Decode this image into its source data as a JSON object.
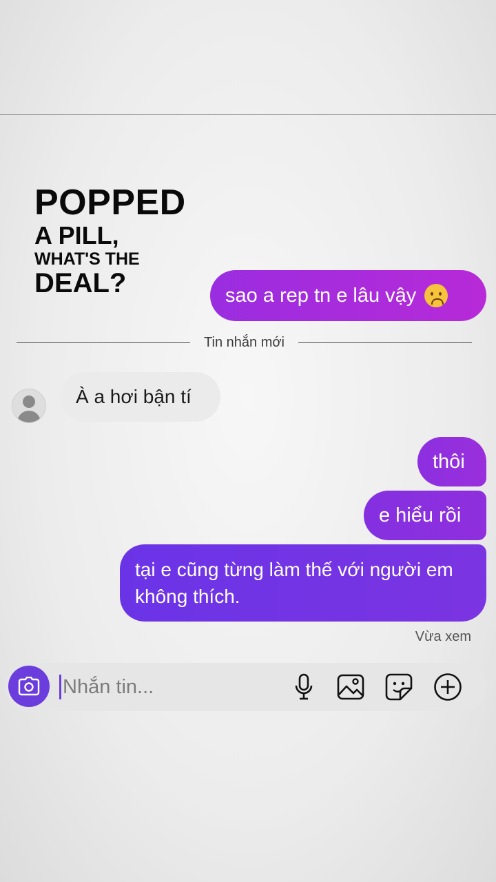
{
  "poster": {
    "line1": "POPPED",
    "line2": "A PILL,",
    "line3": "WHAT'S THE",
    "line4": "DEAL?"
  },
  "messages": {
    "outgoing_1": "sao a rep tn e lâu vậy",
    "outgoing_1_emoji": "frowning-face",
    "divider_label": "Tin nhắn mới",
    "incoming_1": "À a hơi bận tí",
    "outgoing_2": "thôi",
    "outgoing_3": "e hiểu rồi",
    "outgoing_4": "tại e cũng từng làm thế với người em không thích.",
    "seen_status": "Vừa xem"
  },
  "composer": {
    "placeholder": "Nhắn tin...",
    "icons": [
      "camera-icon",
      "microphone-icon",
      "image-icon",
      "sticker-icon",
      "plus-icon"
    ]
  },
  "colors": {
    "accent": "#6b3ddc",
    "bubble_top": "#b72ad8",
    "bubble_bottom": "#6a34e6",
    "incoming_bubble": "#ebebeb"
  }
}
